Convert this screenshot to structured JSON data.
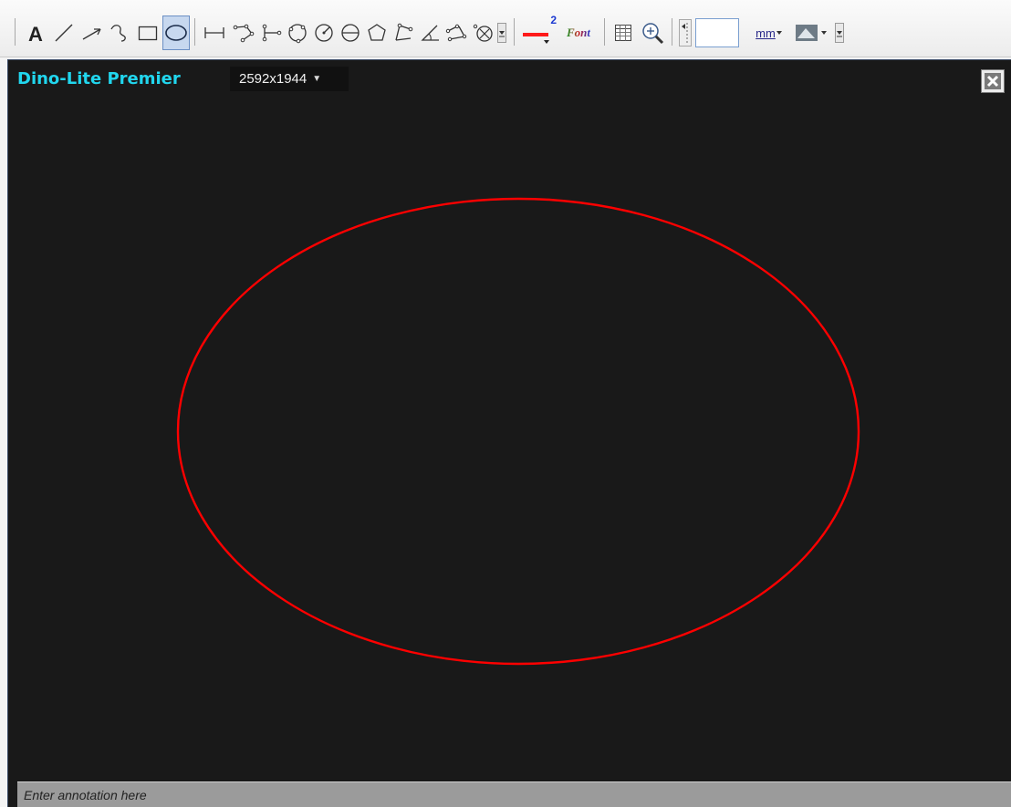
{
  "toolbar": {
    "tools": [
      {
        "name": "text-tool",
        "icon": "text-A-icon"
      },
      {
        "name": "line-tool",
        "icon": "line-icon"
      },
      {
        "name": "arrow-tool",
        "icon": "arrow-icon"
      },
      {
        "name": "freehand-tool",
        "icon": "freehand-icon"
      },
      {
        "name": "rectangle-tool",
        "icon": "rectangle-icon"
      },
      {
        "name": "ellipse-tool",
        "icon": "ellipse-icon",
        "selected": true
      },
      {
        "name": "measure-line-tool",
        "icon": "measure-line-icon"
      },
      {
        "name": "measure-polyline-tool",
        "icon": "polyline-icon"
      },
      {
        "name": "measure-parallel-tool",
        "icon": "parallel-icon"
      },
      {
        "name": "measure-circle-3pt-tool",
        "icon": "circle-3pt-icon"
      },
      {
        "name": "measure-circle-radius-tool",
        "icon": "circle-radius-icon"
      },
      {
        "name": "measure-circle-diameter-tool",
        "icon": "circle-diameter-icon"
      },
      {
        "name": "measure-polygon-tool",
        "icon": "polygon-icon"
      },
      {
        "name": "measure-angle-3pt-tool",
        "icon": "angle-3pt-icon"
      },
      {
        "name": "measure-angle-tool",
        "icon": "angle-icon"
      },
      {
        "name": "measure-angle-4pt-tool",
        "icon": "angle-4pt-icon"
      },
      {
        "name": "measure-center-tool",
        "icon": "center-distance-icon"
      }
    ],
    "line_width_label": "2",
    "font_label": "Font",
    "unit_label": "mm",
    "width_value": "",
    "colors": {
      "accent": "#ff1a1a",
      "selected_bg": "#c7d8ef"
    }
  },
  "viewer": {
    "device_name": "Dino-Lite Premier",
    "resolution": "2592x1944",
    "annotation_placeholder": "Enter annotation here",
    "shape_color": "#ff0000",
    "background": "#191919"
  }
}
